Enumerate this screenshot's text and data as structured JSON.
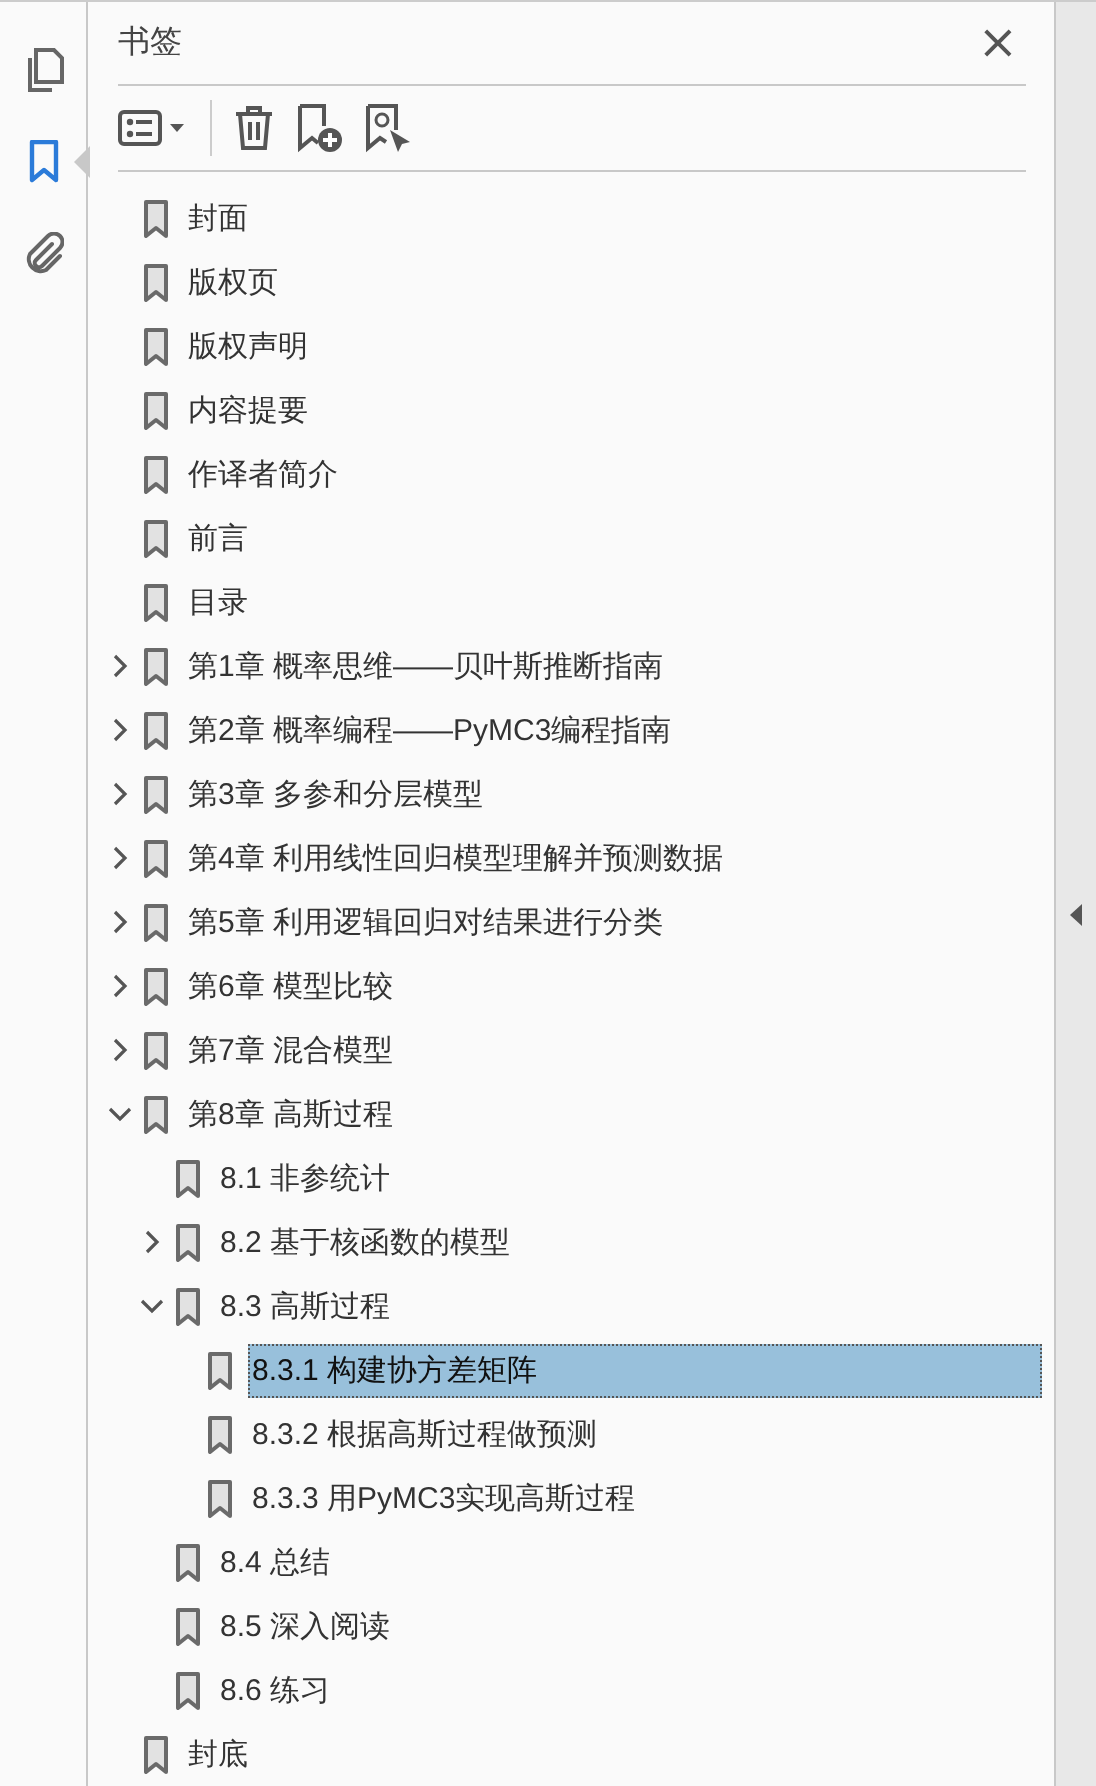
{
  "rail": [
    {
      "kind": "pages",
      "selected": false
    },
    {
      "kind": "bookmarks",
      "selected": true
    },
    {
      "kind": "attachments",
      "selected": false
    }
  ],
  "panel": {
    "title": "书签",
    "close": "×"
  },
  "bookmarks": [
    {
      "label": "封面",
      "selected": false
    },
    {
      "label": "版权页",
      "selected": false
    },
    {
      "label": "版权声明",
      "selected": false
    },
    {
      "label": "内容提要",
      "selected": false
    },
    {
      "label": "作译者简介",
      "selected": false
    },
    {
      "label": "前言",
      "selected": false
    },
    {
      "label": "目录",
      "selected": false
    },
    {
      "label": "第1章 概率思维——贝叶斯推断指南",
      "expanded": false,
      "selected": false
    },
    {
      "label": "第2章 概率编程——PyMC3编程指南",
      "expanded": false,
      "selected": false
    },
    {
      "label": "第3章 多参和分层模型",
      "expanded": false,
      "selected": false
    },
    {
      "label": "第4章 利用线性回归模型理解并预测数据",
      "expanded": false,
      "selected": false
    },
    {
      "label": "第5章 利用逻辑回归对结果进行分类",
      "expanded": false,
      "selected": false
    },
    {
      "label": "第6章 模型比较",
      "expanded": false,
      "selected": false
    },
    {
      "label": "第7章 混合模型",
      "expanded": false,
      "selected": false
    },
    {
      "label": "第8章 高斯过程",
      "expanded": true,
      "selected": false,
      "children": [
        {
          "label": "8.1 非参统计",
          "selected": false
        },
        {
          "label": "8.2 基于核函数的模型",
          "expanded": false,
          "selected": false
        },
        {
          "label": "8.3 高斯过程",
          "expanded": true,
          "selected": false,
          "children": [
            {
              "label": "8.3.1 构建协方差矩阵",
              "selected": true
            },
            {
              "label": "8.3.2 根据高斯过程做预测",
              "selected": false
            },
            {
              "label": "8.3.3 用PyMC3实现高斯过程",
              "selected": false
            }
          ]
        },
        {
          "label": "8.4 总结",
          "selected": false
        },
        {
          "label": "8.5 深入阅读",
          "selected": false
        },
        {
          "label": "8.6 练习",
          "selected": false
        }
      ]
    },
    {
      "label": "封底",
      "selected": false
    }
  ]
}
